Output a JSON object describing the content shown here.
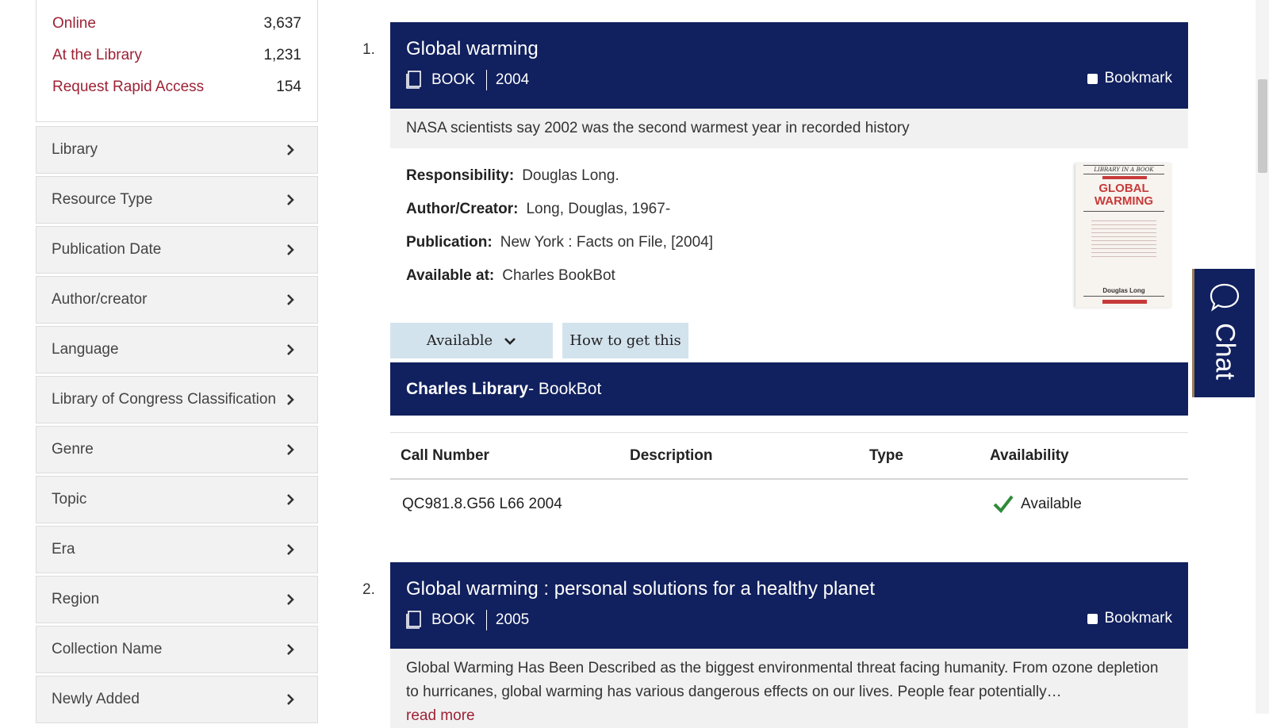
{
  "availability_facets": [
    {
      "label": "Online",
      "count": "3,637"
    },
    {
      "label": "At the Library",
      "count": "1,231"
    },
    {
      "label": "Request Rapid Access",
      "count": "154"
    }
  ],
  "facets": [
    "Library",
    "Resource Type",
    "Publication Date",
    "Author/creator",
    "Language",
    "Library of Congress Classification",
    "Genre",
    "Topic",
    "Era",
    "Region",
    "Collection Name",
    "Newly Added"
  ],
  "results": [
    {
      "number": "1.",
      "title": "Global warming",
      "type": "BOOK",
      "year": "2004",
      "bookmark": "Bookmark",
      "snippet": "NASA scientists say 2002 was the second warmest year in recorded history",
      "fields": [
        {
          "label": "Responsibility:",
          "value": "Douglas Long."
        },
        {
          "label": "Author/Creator:",
          "value": "Long, Douglas, 1967-"
        },
        {
          "label": "Publication:",
          "value": "New York : Facts on File, [2004]"
        },
        {
          "label": "Available at:",
          "value": "Charles BookBot"
        }
      ],
      "cover": {
        "series": "LIBRARY IN A BOOK",
        "title_line1": "GLOBAL",
        "title_line2": "WARMING",
        "author": "Douglas Long"
      },
      "available_button": "Available",
      "how_button": "How to get this",
      "location_library": "Charles Library",
      "location_sub": " - BookBot",
      "holdings_headers": [
        "Call Number",
        "Description",
        "Type",
        "Availability"
      ],
      "holding": {
        "call_number": "QC981.8.G56 L66 2004",
        "description": "",
        "type": "",
        "availability": "Available"
      }
    },
    {
      "number": "2.",
      "title": "Global warming : personal solutions for a healthy planet",
      "type": "BOOK",
      "year": "2005",
      "bookmark": "Bookmark",
      "snippet": "Global Warming Has Been Described as the biggest environmental threat facing humanity. From ozone depletion to hurricanes, global warming has various dangerous effects on our lives. People fear potentially…",
      "read_more": "read more"
    }
  ],
  "chat_label": "Chat",
  "colors": {
    "navy": "#11205e",
    "maroon": "#9d2235",
    "check_green": "#2e8b3a",
    "button_blue": "#d3e3ee"
  }
}
